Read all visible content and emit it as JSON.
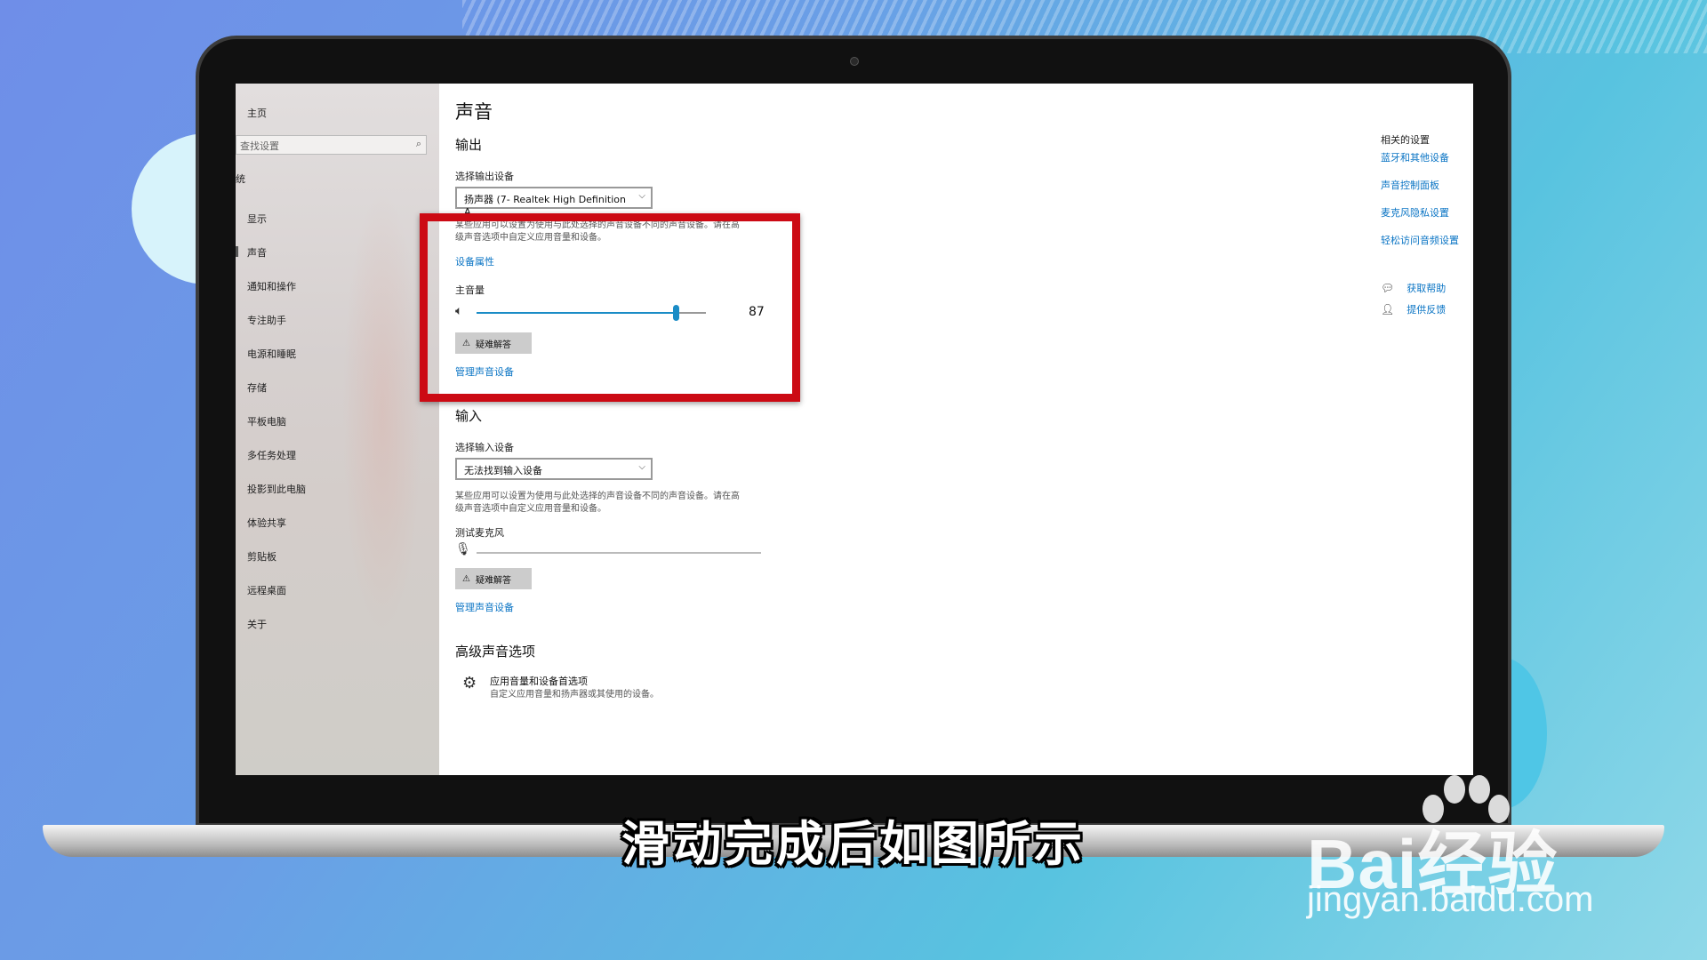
{
  "sidebar": {
    "home": "主页",
    "search_placeholder": "查找设置",
    "section": "统",
    "items": [
      {
        "label": "显示"
      },
      {
        "label": "声音"
      },
      {
        "label": "通知和操作"
      },
      {
        "label": "专注助手"
      },
      {
        "label": "电源和睡眠"
      },
      {
        "label": "存储"
      },
      {
        "label": "平板电脑"
      },
      {
        "label": "多任务处理"
      },
      {
        "label": "投影到此电脑"
      },
      {
        "label": "体验共享"
      },
      {
        "label": "剪贴板"
      },
      {
        "label": "远程桌面"
      },
      {
        "label": "关于"
      }
    ]
  },
  "page": {
    "title": "声音",
    "output": {
      "heading": "输出",
      "select_label": "选择输出设备",
      "device": "扬声器 (7- Realtek High Definition A...",
      "desc_line1": "某些应用可以设置为使用与此处选择的声音设备不同的声音设备。请在高",
      "desc_line2": "级声音选项中自定义应用音量和设备。",
      "device_props_link": "设备属性",
      "volume_label": "主音量",
      "volume_value": 87,
      "volume_text": "87",
      "troubleshoot": "疑难解答",
      "manage_link": "管理声音设备"
    },
    "input": {
      "heading": "输入",
      "select_label": "选择输入设备",
      "device": "无法找到输入设备",
      "desc_line1": "某些应用可以设置为使用与此处选择的声音设备不同的声音设备。请在高",
      "desc_line2": "级声音选项中自定义应用音量和设备。",
      "test_mic_label": "测试麦克风",
      "troubleshoot": "疑难解答",
      "manage_link": "管理声音设备"
    },
    "advanced": {
      "heading": "高级声音选项",
      "item_title": "应用音量和设备首选项",
      "item_desc": "自定义应用音量和扬声器或其使用的设备。"
    }
  },
  "related": {
    "title": "相关的设置",
    "links": [
      "蓝牙和其他设备",
      "声音控制面板",
      "麦克风隐私设置",
      "轻松访问音频设置"
    ],
    "help": "获取帮助",
    "feedback": "提供反馈"
  },
  "overlay": {
    "subtitle": "滑动完成后如图所示",
    "watermark_brand": "Bai经验",
    "watermark_url": "jingyan.baidu.com"
  },
  "colors": {
    "accent": "#1a8cc6",
    "link": "#0a74c4",
    "highlight": "#cc0a14"
  }
}
